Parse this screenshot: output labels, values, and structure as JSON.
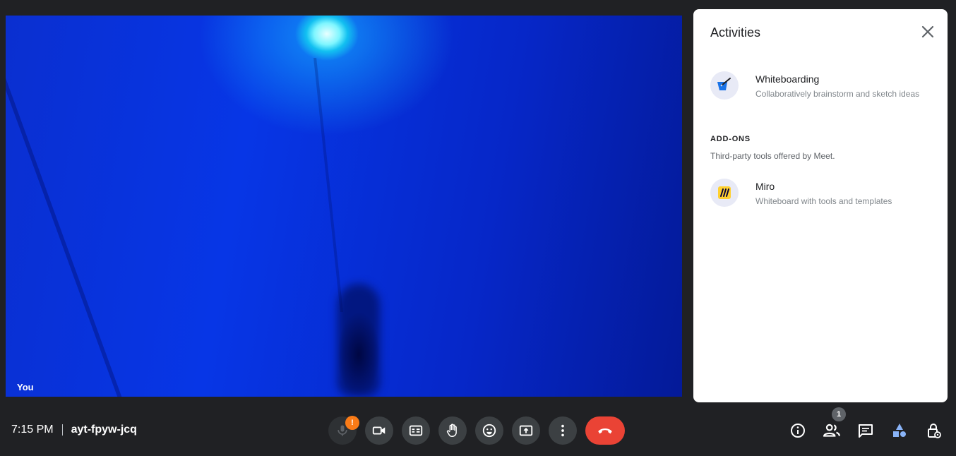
{
  "video": {
    "self_label": "You"
  },
  "activities_panel": {
    "title": "Activities",
    "items": [
      {
        "name": "Whiteboarding",
        "description": "Collaboratively brainstorm and sketch ideas",
        "icon": "whiteboard-icon"
      }
    ],
    "addons": {
      "heading": "ADD-ONS",
      "subtitle": "Third-party tools offered by Meet.",
      "items": [
        {
          "name": "Miro",
          "description": "Whiteboard with tools and templates",
          "icon": "miro-icon"
        }
      ]
    }
  },
  "meeting": {
    "time": "7:15 PM",
    "code": "ayt-fpyw-jcq"
  },
  "controls": {
    "mic_alert": "!",
    "icons": [
      "mic-icon",
      "camera-icon",
      "captions-icon",
      "raise-hand-icon",
      "emoji-icon",
      "present-icon",
      "more-options-icon",
      "end-call-icon"
    ]
  },
  "side_controls": {
    "people_count": "1",
    "icons": [
      "info-icon",
      "people-icon",
      "chat-icon",
      "activities-icon",
      "host-controls-icon"
    ]
  },
  "colors": {
    "end_call": "#ea4335",
    "alert_badge": "#fa7b17",
    "active_icon": "#8ab4f8"
  }
}
